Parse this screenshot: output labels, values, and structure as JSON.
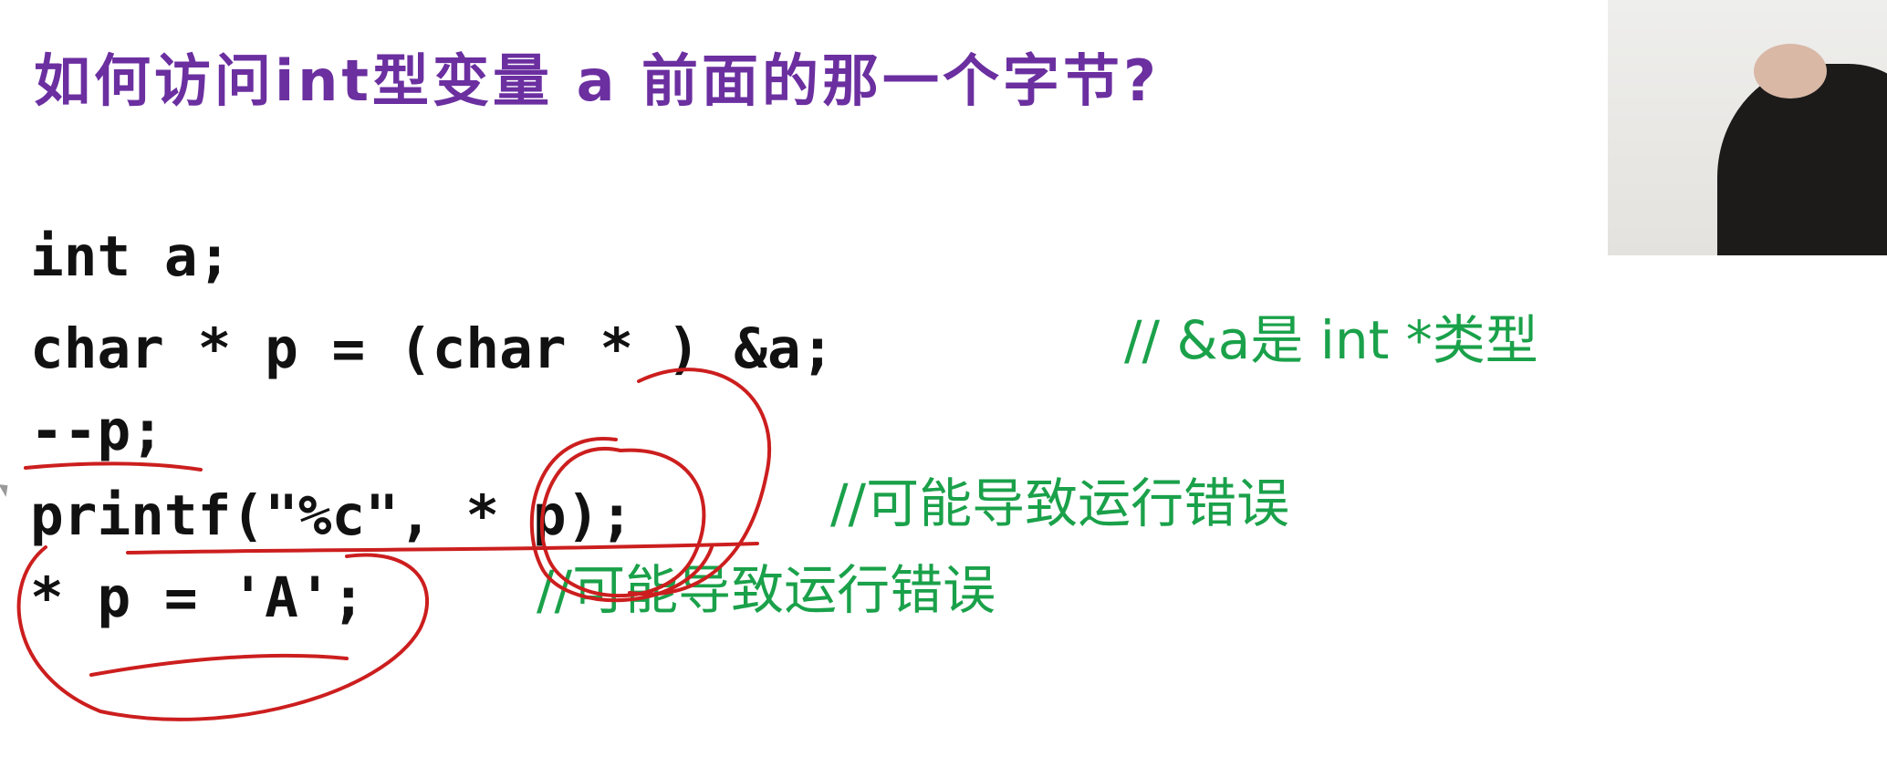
{
  "slide": {
    "title": "如何访问int型变量 a 前面的那一个字节?",
    "code_lines": [
      "int a;",
      "char * p = (char * ) &a;",
      "--p;",
      "printf(\"%c\", * p);",
      "* p = 'A';"
    ],
    "comments": [
      "// &a是 int *类型",
      "//可能导致运行错误",
      "//可能导致运行错误"
    ]
  },
  "colors": {
    "title": "#6b2fa0",
    "code": "#111111",
    "comment": "#1aa14a",
    "annotation": "#cc1e1e"
  },
  "icons": {
    "cursor": "mouse-pointer-icon"
  }
}
